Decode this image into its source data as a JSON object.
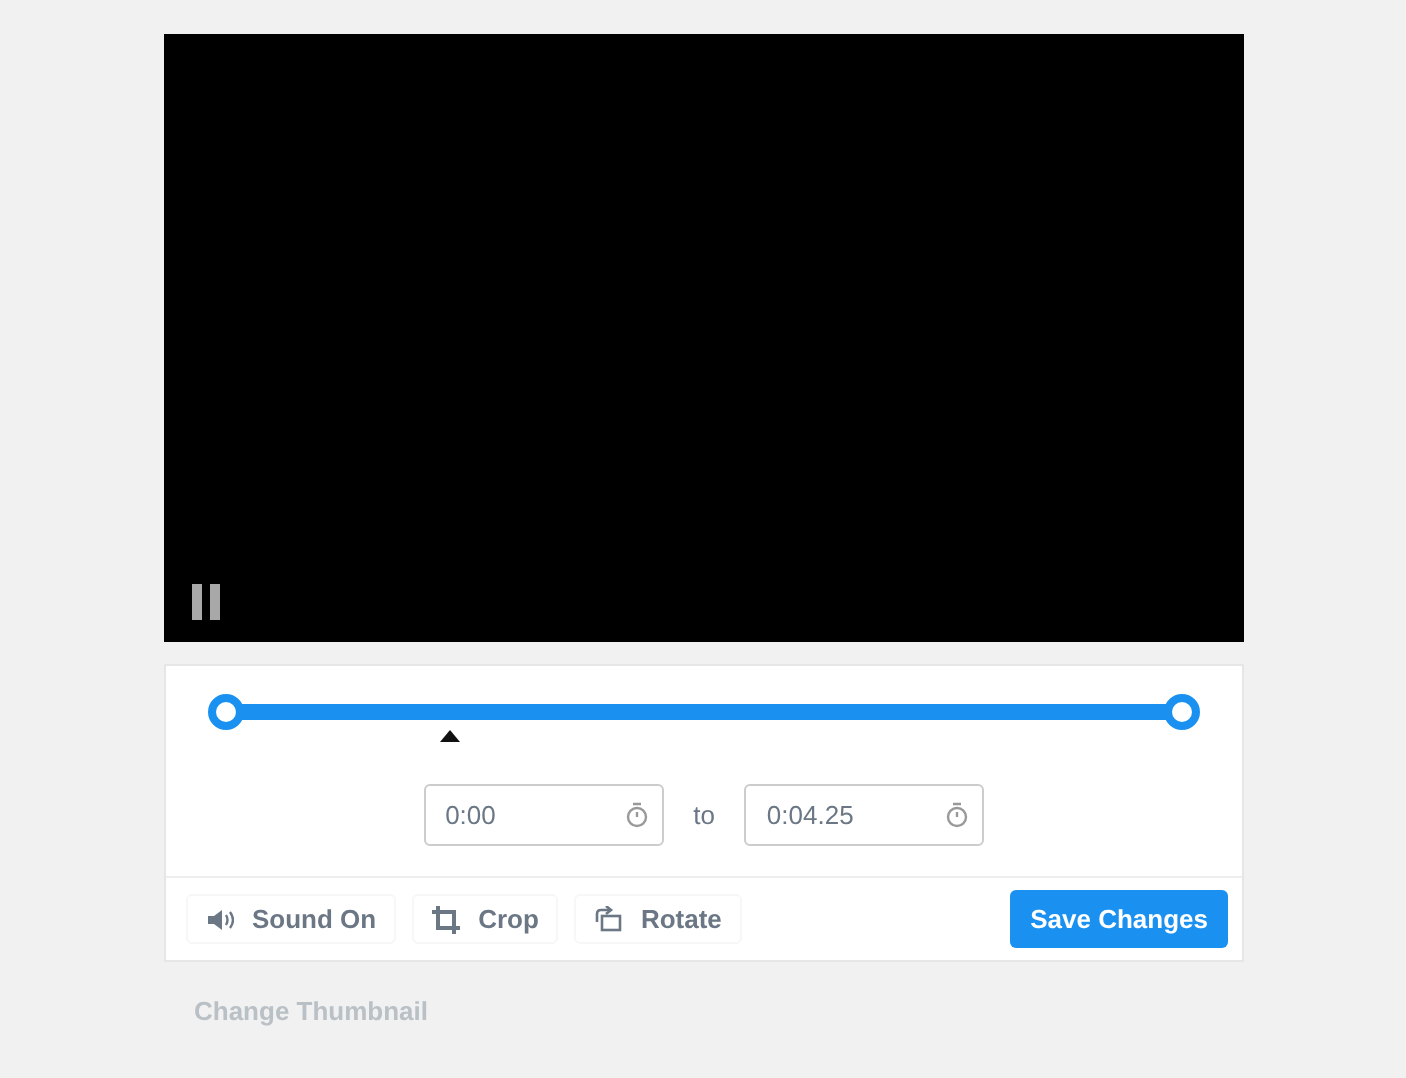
{
  "trim": {
    "playhead": {
      "level": 0.234
    }
  },
  "times": {
    "start": {
      "value": "0:00"
    },
    "separator": "to",
    "end": {
      "value": "0:04.25"
    }
  },
  "actions": [
    {
      "kind": "sound",
      "label": "Sound On"
    },
    {
      "kind": "crop",
      "label": "Crop"
    },
    {
      "kind": "rotate",
      "label": "Rotate"
    }
  ],
  "save_button": "Save Changes",
  "thumbnail_link": "Change Thumbnail"
}
